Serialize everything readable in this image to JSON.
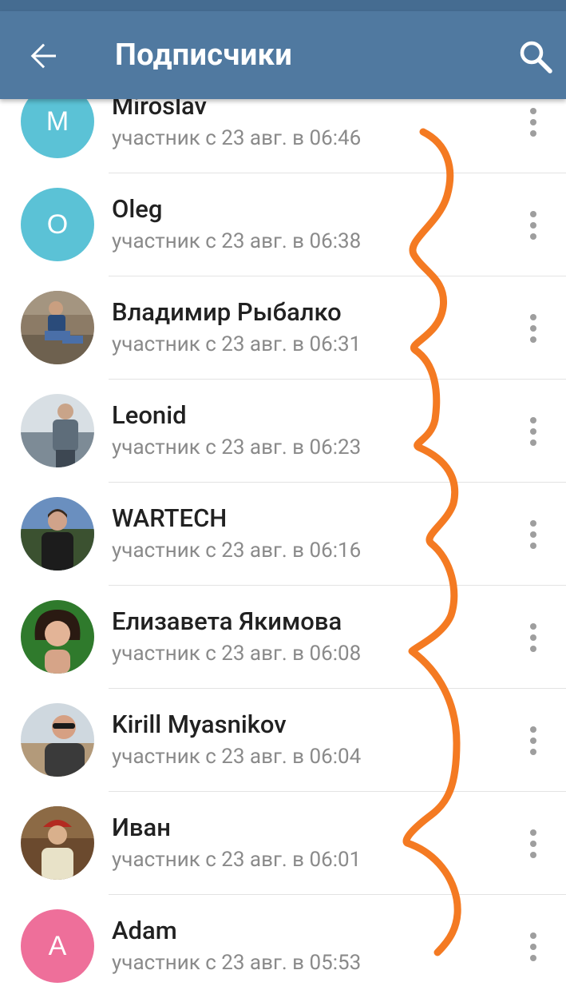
{
  "header": {
    "title": "Подписчики",
    "back_icon": "arrow-back-icon",
    "search_icon": "search-icon",
    "color": "#5079a0"
  },
  "members": [
    {
      "name": "Miroslav",
      "status": "участник с 23 авг. в 06:46",
      "initial": "M",
      "avatar_color": "#5bc2d6"
    },
    {
      "name": "Oleg",
      "status": "участник с 23 авг. в 06:38",
      "initial": "O",
      "avatar_color": "#5bc2d6"
    },
    {
      "name": "Владимир Рыбалко",
      "status": "участник с 23 авг. в 06:31",
      "initial": "",
      "avatar_color": "#7b6a58"
    },
    {
      "name": "Leonid",
      "status": "участник с 23 авг. в 06:23",
      "initial": "",
      "avatar_color": "#9aa7b1"
    },
    {
      "name": "WARTECH",
      "status": "участник с 23 авг. в 06:16",
      "initial": "",
      "avatar_color": "#3f5a3a"
    },
    {
      "name": "Елизавета Якимова",
      "status": "участник с 23 авг. в 06:08",
      "initial": "",
      "avatar_color": "#2d6b2a"
    },
    {
      "name": "Kirill Myasnikov",
      "status": "участник с 23 авг. в 06:04",
      "initial": "",
      "avatar_color": "#b5a58e"
    },
    {
      "name": "Иван",
      "status": "участник с 23 авг. в 06:01",
      "initial": "",
      "avatar_color": "#8a5a3a"
    },
    {
      "name": "Adam",
      "status": "участник с 23 авг. в 05:53",
      "initial": "A",
      "avatar_color": "#ee6f9a"
    }
  ],
  "annotation_color": "#f47a22"
}
